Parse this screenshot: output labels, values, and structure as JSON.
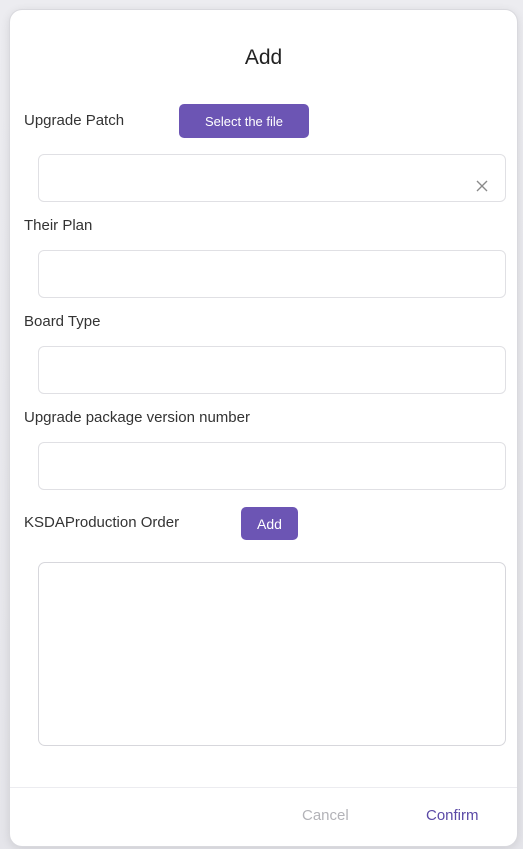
{
  "dialog": {
    "title": "Add",
    "upgrade_patch": {
      "label": "Upgrade Patch",
      "select_button": "Select the file",
      "value": ""
    },
    "their_plan": {
      "label": "Their Plan",
      "value": ""
    },
    "board_type": {
      "label": "Board Type",
      "value": ""
    },
    "version_number": {
      "label": "Upgrade package version number",
      "value": ""
    },
    "production_order": {
      "label": "KSDAProduction Order",
      "add_button": "Add",
      "value": ""
    },
    "footer": {
      "cancel": "Cancel",
      "confirm": "Confirm"
    }
  },
  "icons": {
    "clear": "close-icon"
  },
  "colors": {
    "accent": "#6c55b4",
    "confirm_text": "#5b4aa6",
    "cancel_text": "#b3b3b8"
  }
}
